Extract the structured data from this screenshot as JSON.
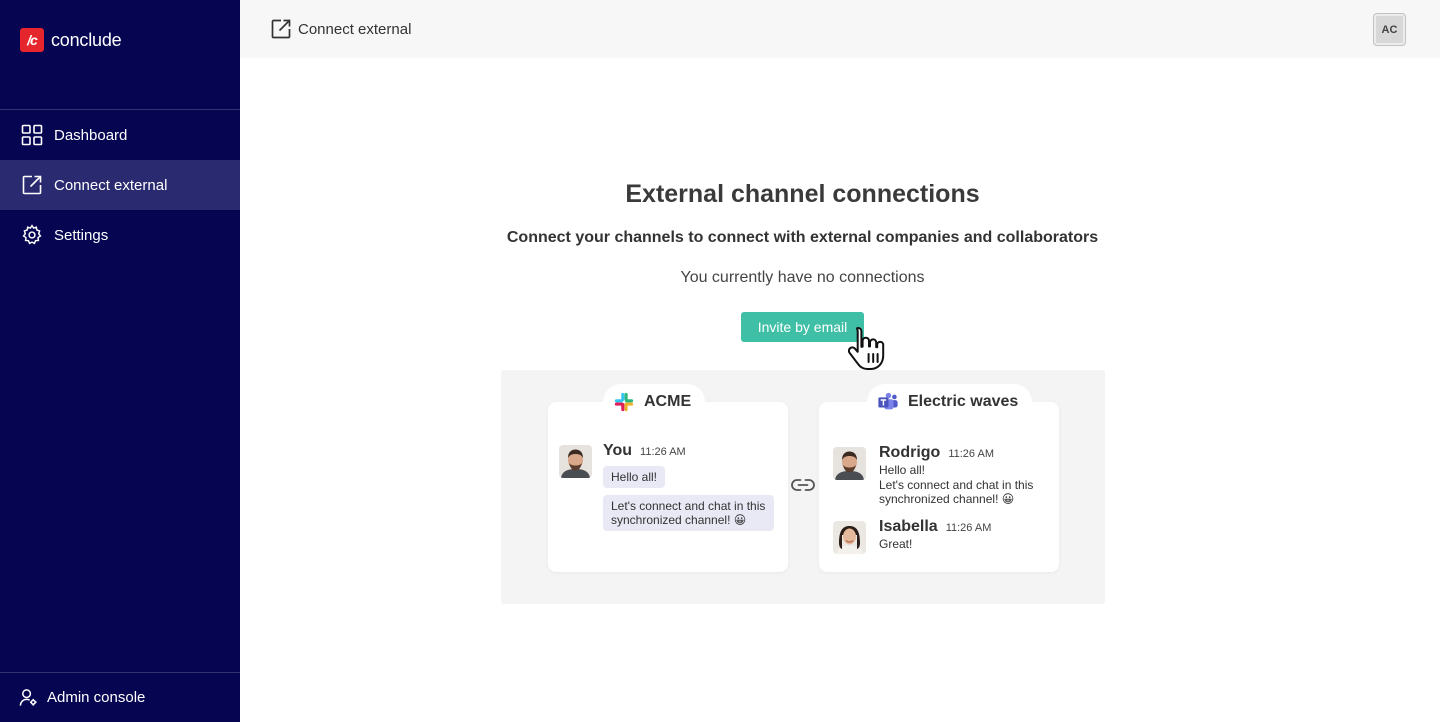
{
  "app": {
    "name": "conclude",
    "logo_mark": "/c",
    "brand_color": "#e5262c",
    "sidebar_color": "#050552",
    "accent_color": "#3fbfa6"
  },
  "sidebar": {
    "items": [
      {
        "label": "Dashboard",
        "icon": "grid-icon",
        "active": false
      },
      {
        "label": "Connect external",
        "icon": "external-link-icon",
        "active": true
      },
      {
        "label": "Settings",
        "icon": "gear-icon",
        "active": false
      }
    ],
    "footer": {
      "label": "Admin console",
      "icon": "admin-user-icon"
    }
  },
  "header": {
    "title": "Connect external",
    "icon": "external-link-icon",
    "avatar_initials": "AC"
  },
  "main": {
    "title": "External channel connections",
    "subtitle": "Connect your channels to connect with external companies and collaborators",
    "empty_state": "You currently have no connections",
    "invite_button": "Invite by email"
  },
  "illustration": {
    "left": {
      "workspace": "ACME",
      "icon": "slack-icon",
      "message": {
        "author": "You",
        "time": "11:26 AM",
        "lines": [
          "Hello all!",
          "Let's connect and chat in this synchronized channel! 😀"
        ]
      }
    },
    "right": {
      "workspace": "Electric waves",
      "icon": "teams-icon",
      "messages": [
        {
          "author": "Rodrigo",
          "time": "11:26 AM",
          "text": [
            "Hello all!",
            "Let's connect and chat in this",
            "synchronized channel! 😀"
          ]
        },
        {
          "author": "Isabella",
          "time": "11:26 AM",
          "text": [
            "Great!"
          ]
        }
      ]
    },
    "link_icon": "chain-link-icon"
  }
}
